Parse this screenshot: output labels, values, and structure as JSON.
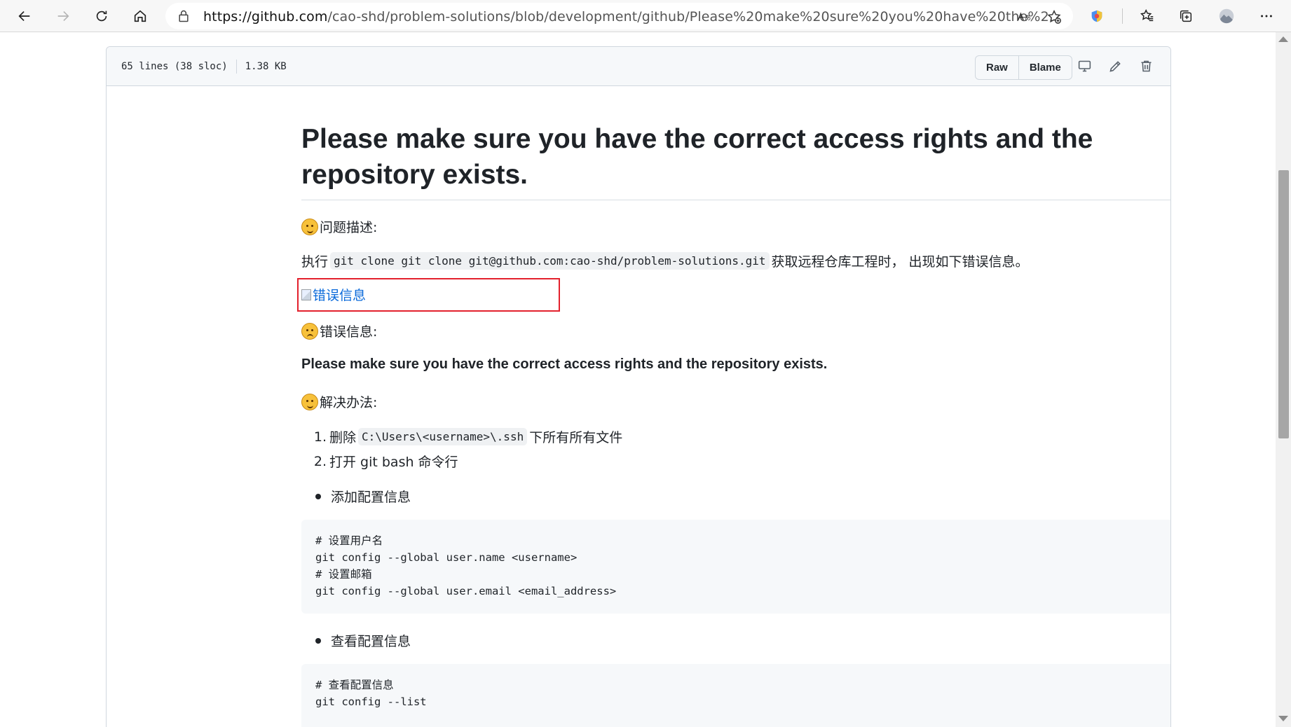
{
  "browser": {
    "url_host": "https://github.com",
    "url_path": "/cao-shd/problem-solutions/blob/development/github/Please%20make%20sure%20you%20have%20the%2..."
  },
  "file_header": {
    "lines": "65 lines (38 sloc)",
    "size": "1.38 KB",
    "raw_label": "Raw",
    "blame_label": "Blame"
  },
  "content": {
    "title": "Please make sure you have the correct access rights and the repository exists.",
    "problem_heading": "问题描述:",
    "exec_prefix": "执行",
    "exec_code": "git clone git clone git@github.com:cao-shd/problem-solutions.git",
    "exec_suffix": "获取远程仓库工程时， 出现如下错误信息。",
    "image_alt": "错误信息",
    "error_heading": "错误信息:",
    "error_message": "Please make sure you have the correct access rights and the repository exists.",
    "solution_heading": "解决办法:",
    "step1_num": "1.",
    "step1_prefix": "删除",
    "step1_code": "C:\\Users\\<username>\\.ssh",
    "step1_suffix": "下所有所有文件",
    "step2_num": "2.",
    "step2_text": "打开 git bash 命令行",
    "bullet1": "添加配置信息",
    "code1": "# 设置用户名\ngit config --global user.name <username>\n# 设置邮箱\ngit config --global user.email <email_address>",
    "bullet2": "查看配置信息",
    "code2": "# 查看配置信息\ngit config --list"
  }
}
